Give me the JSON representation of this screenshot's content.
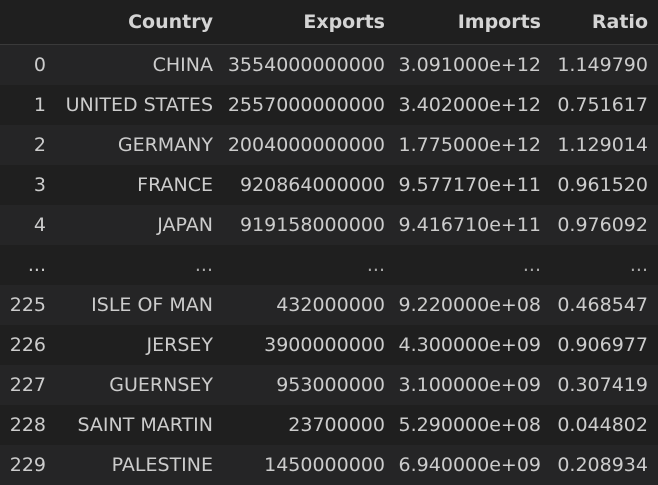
{
  "columns": [
    "",
    "Country",
    "Exports",
    "Imports",
    "Ratio"
  ],
  "rows": [
    [
      "0",
      "CHINA",
      "3554000000000",
      "3.091000e+12",
      "1.149790"
    ],
    [
      "1",
      "UNITED STATES",
      "2557000000000",
      "3.402000e+12",
      "0.751617"
    ],
    [
      "2",
      "GERMANY",
      "2004000000000",
      "1.775000e+12",
      "1.129014"
    ],
    [
      "3",
      "FRANCE",
      "920864000000",
      "9.577170e+11",
      "0.961520"
    ],
    [
      "4",
      "JAPAN",
      "919158000000",
      "9.416710e+11",
      "0.976092"
    ],
    [
      "...",
      "...",
      "...",
      "...",
      "..."
    ],
    [
      "225",
      "ISLE OF MAN",
      "432000000",
      "9.220000e+08",
      "0.468547"
    ],
    [
      "226",
      "JERSEY",
      "3900000000",
      "4.300000e+09",
      "0.906977"
    ],
    [
      "227",
      "GUERNSEY",
      "953000000",
      "3.100000e+09",
      "0.307419"
    ],
    [
      "228",
      "SAINT MARTIN",
      "23700000",
      "5.290000e+08",
      "0.044802"
    ],
    [
      "229",
      "PALESTINE",
      "1450000000",
      "6.940000e+09",
      "0.208934"
    ]
  ]
}
